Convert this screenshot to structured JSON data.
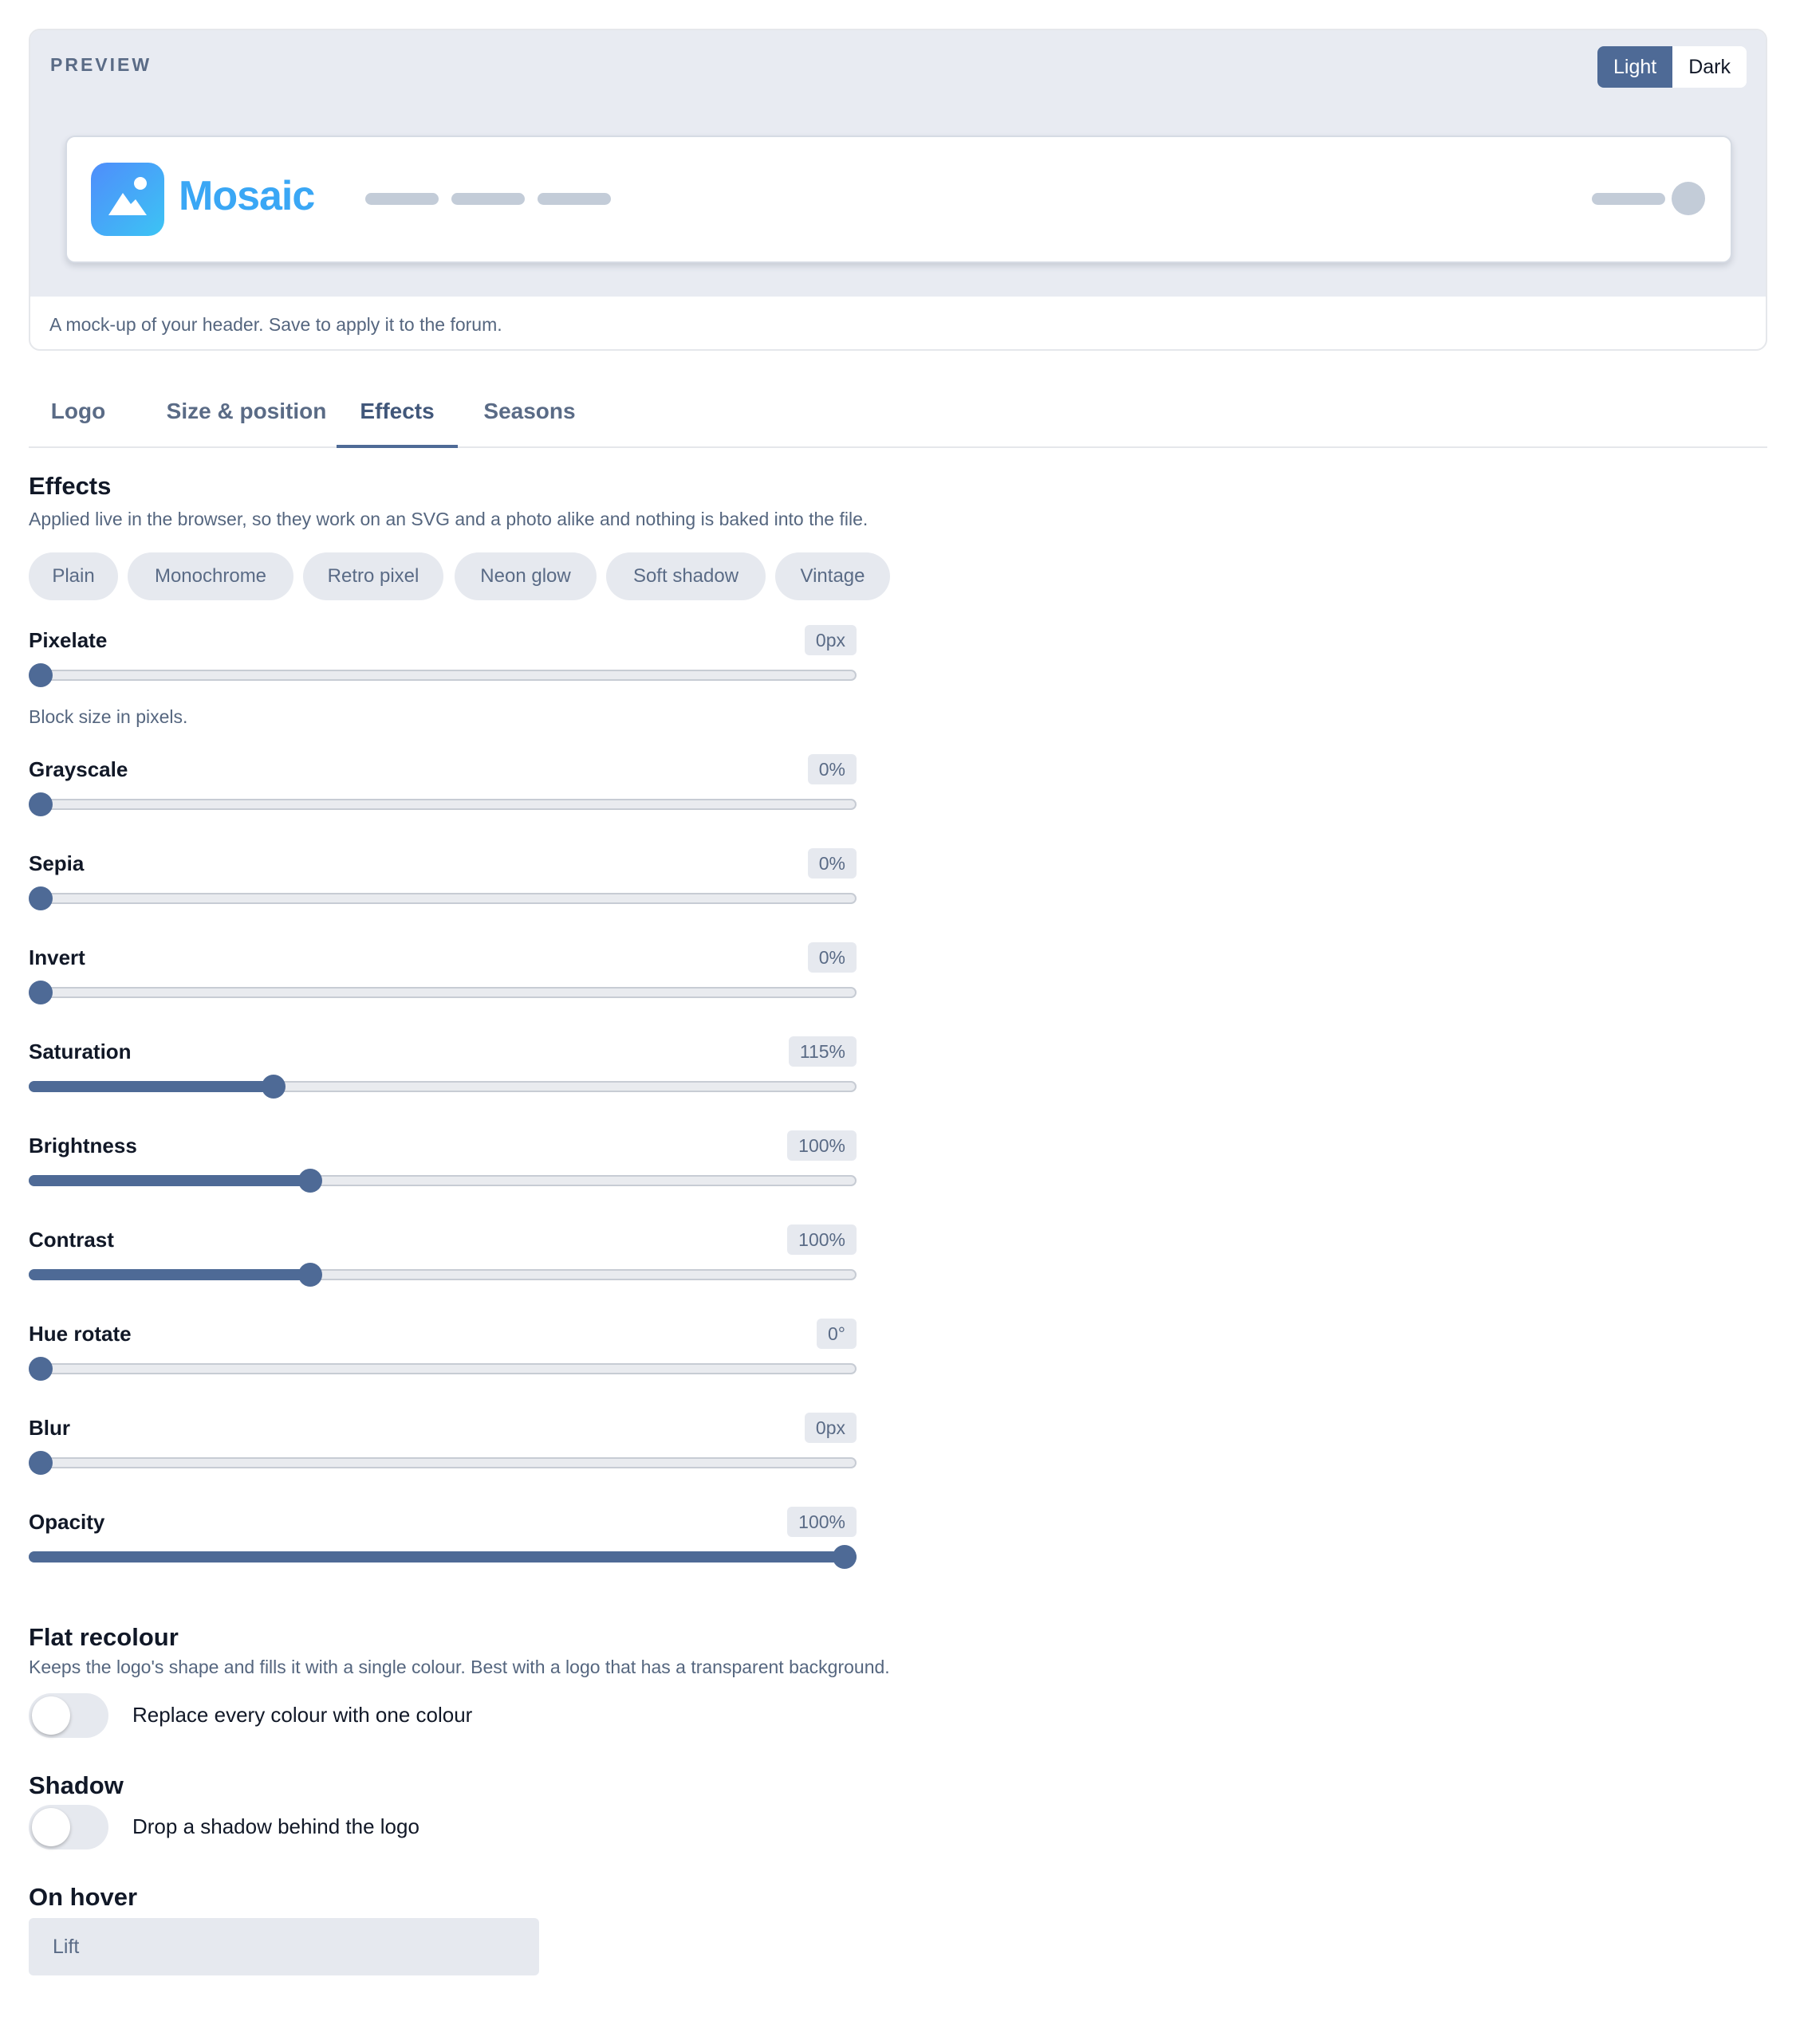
{
  "preview": {
    "label": "PREVIEW",
    "theme_options": [
      "Light",
      "Dark"
    ],
    "theme_selected": "Light",
    "brand_name": "Mosaic",
    "caption": "A mock-up of your header. Save to apply it to the forum."
  },
  "tabs": [
    {
      "label": "Logo",
      "active": false
    },
    {
      "label": "Size & position",
      "active": false
    },
    {
      "label": "Effects",
      "active": true
    },
    {
      "label": "Seasons",
      "active": false
    }
  ],
  "effects": {
    "title": "Effects",
    "description": "Applied live in the browser, so they work on an SVG and a photo alike and nothing is baked into the file.",
    "presets": [
      "Plain",
      "Monochrome",
      "Retro pixel",
      "Neon glow",
      "Soft shadow",
      "Vintage"
    ],
    "pixelate_help": "Block size in pixels.",
    "sliders": [
      {
        "label": "Pixelate",
        "value": "0px",
        "fraction": 0.0
      },
      {
        "label": "Grayscale",
        "value": "0%",
        "fraction": 0.0
      },
      {
        "label": "Sepia",
        "value": "0%",
        "fraction": 0.0
      },
      {
        "label": "Invert",
        "value": "0%",
        "fraction": 0.0
      },
      {
        "label": "Saturation",
        "value": "115%",
        "fraction": 0.29
      },
      {
        "label": "Brightness",
        "value": "100%",
        "fraction": 0.335
      },
      {
        "label": "Contrast",
        "value": "100%",
        "fraction": 0.335
      },
      {
        "label": "Hue rotate",
        "value": "0°",
        "fraction": 0.0
      },
      {
        "label": "Blur",
        "value": "0px",
        "fraction": 0.0
      },
      {
        "label": "Opacity",
        "value": "100%",
        "fraction": 1.0
      }
    ]
  },
  "flat_recolour": {
    "title": "Flat recolour",
    "description": "Keeps the logo's shape and fills it with a single colour. Best with a logo that has a transparent background.",
    "toggle_label": "Replace every colour with one colour",
    "enabled": false
  },
  "shadow": {
    "title": "Shadow",
    "toggle_label": "Drop a shadow behind the logo",
    "enabled": false
  },
  "on_hover": {
    "title": "On hover",
    "selected": "Lift"
  },
  "colors": {
    "accent": "#4e6a96",
    "preview_bg": "#e8ebf2",
    "brand_gradient_start": "#4f8dfb",
    "brand_gradient_end": "#3cc4f4"
  }
}
